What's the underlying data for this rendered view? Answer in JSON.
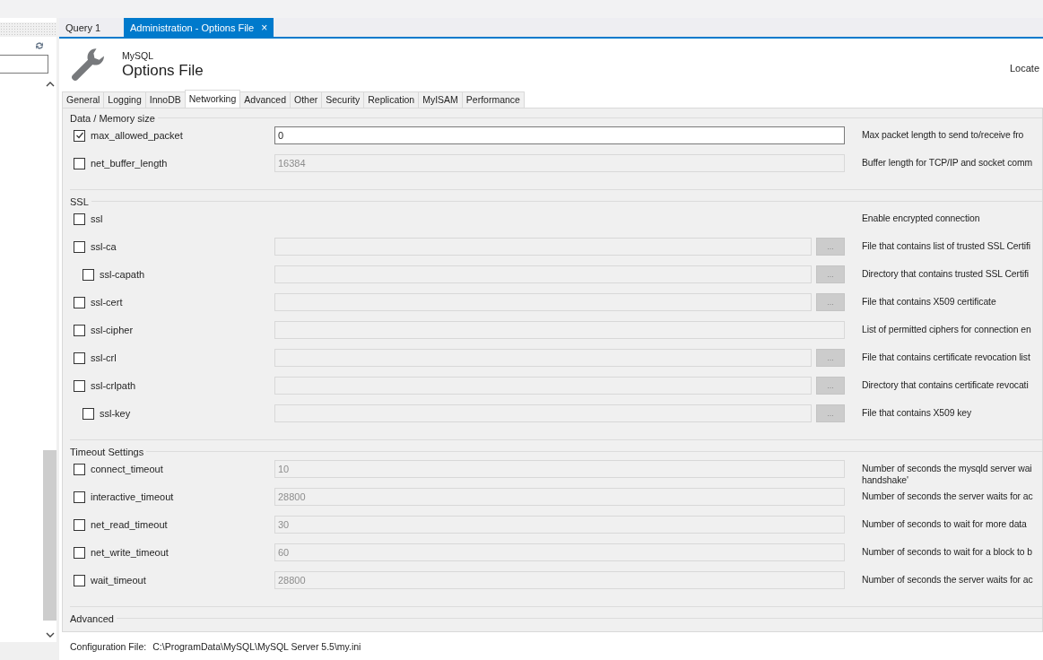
{
  "doc_tabs": [
    {
      "label": "Query 1",
      "selected": false
    },
    {
      "label": "Administration - Options File",
      "selected": true,
      "close": "×"
    }
  ],
  "header": {
    "subtitle": "MySQL",
    "title": "Options File",
    "locate": "Locate"
  },
  "option_tabs": [
    {
      "label": "General",
      "selected": false
    },
    {
      "label": "Logging",
      "selected": false
    },
    {
      "label": "InnoDB",
      "selected": false
    },
    {
      "label": "Networking",
      "selected": true
    },
    {
      "label": "Advanced",
      "selected": false
    },
    {
      "label": "Other",
      "selected": false
    },
    {
      "label": "Security",
      "selected": false
    },
    {
      "label": "Replication",
      "selected": false
    },
    {
      "label": "MyISAM",
      "selected": false
    },
    {
      "label": "Performance",
      "selected": false
    }
  ],
  "groups": [
    {
      "title": "Data / Memory size",
      "options": [
        {
          "name": "max_allowed_packet",
          "checked": true,
          "kind": "text",
          "value": "0",
          "disabled": false,
          "description": "Max packet length to send to/receive fro"
        },
        {
          "name": "net_buffer_length",
          "checked": false,
          "kind": "text",
          "value": "16384",
          "disabled": true,
          "description": "Buffer length for TCP/IP and socket comm"
        }
      ]
    },
    {
      "title": "SSL",
      "options": [
        {
          "name": "ssl",
          "checked": false,
          "kind": "flag",
          "description": "Enable encrypted connection"
        },
        {
          "name": "ssl-ca",
          "checked": false,
          "kind": "file",
          "disabled": true,
          "browse": "...",
          "description": "File that contains list of trusted SSL Certifi",
          "children": [
            {
              "name": "ssl-capath",
              "checked": false,
              "kind": "file",
              "disabled": true,
              "browse": "...",
              "description": "Directory that contains trusted SSL Certifi"
            }
          ]
        },
        {
          "name": "ssl-cert",
          "checked": false,
          "kind": "file",
          "disabled": true,
          "browse": "...",
          "description": "File that contains X509 certificate"
        },
        {
          "name": "ssl-cipher",
          "checked": false,
          "kind": "text",
          "disabled": true,
          "description": "List of permitted ciphers for connection en"
        },
        {
          "name": "ssl-crl",
          "checked": false,
          "kind": "file",
          "disabled": true,
          "browse": "...",
          "description": "File that contains certificate revocation list"
        },
        {
          "name": "ssl-crlpath",
          "checked": false,
          "kind": "file",
          "disabled": true,
          "browse": "...",
          "description": "Directory that contains certificate revocati",
          "children": [
            {
              "name": "ssl-key",
              "checked": false,
              "kind": "file",
              "disabled": true,
              "browse": "...",
              "description": "File that contains X509 key"
            }
          ]
        }
      ]
    },
    {
      "title": "Timeout Settings",
      "options": [
        {
          "name": "connect_timeout",
          "checked": false,
          "kind": "text",
          "value": "10",
          "disabled": true,
          "description": "Number of seconds the mysqld server wai\nhandshake'"
        },
        {
          "name": "interactive_timeout",
          "checked": false,
          "kind": "text",
          "value": "28800",
          "disabled": true,
          "description": "Number of seconds the server waits for ac"
        },
        {
          "name": "net_read_timeout",
          "checked": false,
          "kind": "text",
          "value": "30",
          "disabled": true,
          "description": "Number of seconds to wait for more data"
        },
        {
          "name": "net_write_timeout",
          "checked": false,
          "kind": "text",
          "value": "60",
          "disabled": true,
          "description": "Number of seconds to wait for a block to b"
        },
        {
          "name": "wait_timeout",
          "checked": false,
          "kind": "text",
          "value": "28800",
          "disabled": true,
          "description": "Number of seconds the server waits for ac"
        }
      ]
    },
    {
      "title": "Advanced"
    }
  ],
  "footer": {
    "label": "Configuration File:",
    "path": "C:\\ProgramData\\MySQL\\MySQL Server 5.5\\my.ini"
  }
}
